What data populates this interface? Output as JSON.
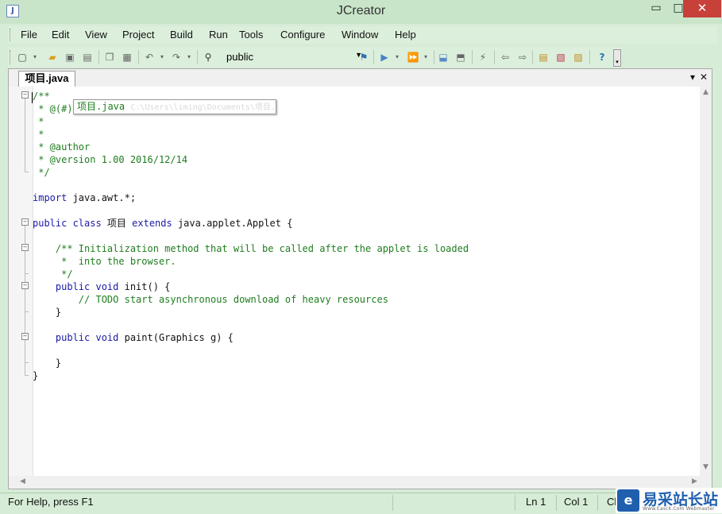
{
  "window": {
    "title": "JCreator",
    "app_icon": "jcreator-icon",
    "controls": {
      "minimize": "▭",
      "maximize": "□",
      "close": "✕"
    }
  },
  "menu": [
    "File",
    "Edit",
    "View",
    "Project",
    "Build",
    "Run",
    "Tools",
    "Configure",
    "Window",
    "Help"
  ],
  "toolbar": {
    "find_value": "public",
    "icons": [
      "new-icon",
      "open-icon",
      "save-icon",
      "save-all-icon",
      "copy-icon",
      "paste-icon",
      "undo-icon",
      "redo-icon",
      "find-icon",
      "find-in-files-icon",
      "run-icon",
      "debug-icon",
      "compile-file-icon",
      "build-project-icon",
      "stop-icon",
      "back-icon",
      "forward-icon",
      "bookmark-icon",
      "toggle-icon",
      "options-icon",
      "help-icon"
    ]
  },
  "editor": {
    "tab_label": "项目.java",
    "tab_controls": {
      "list": "▾",
      "close": "✕"
    },
    "tooltip_text": "项目.java",
    "tooltip_ghost": "C:\\Users\\liming\\Documents\\项目.java",
    "code_lines": [
      {
        "parts": [
          {
            "t": "/**",
            "c": "cm"
          }
        ]
      },
      {
        "parts": [
          {
            "t": " * @(#)",
            "c": "cm"
          }
        ]
      },
      {
        "parts": [
          {
            "t": " *",
            "c": "cm"
          }
        ]
      },
      {
        "parts": [
          {
            "t": " *",
            "c": "cm"
          }
        ]
      },
      {
        "parts": [
          {
            "t": " * @author",
            "c": "cm"
          }
        ]
      },
      {
        "parts": [
          {
            "t": " * @version 1.00 2016/12/14",
            "c": "cm"
          }
        ]
      },
      {
        "parts": [
          {
            "t": " */",
            "c": "cm"
          }
        ]
      },
      {
        "parts": []
      },
      {
        "parts": [
          {
            "t": "import",
            "c": "kw"
          },
          {
            "t": " java.awt.*;",
            "c": "pl"
          }
        ]
      },
      {
        "parts": []
      },
      {
        "parts": [
          {
            "t": "public class",
            "c": "kw"
          },
          {
            "t": " 项目 ",
            "c": "pl"
          },
          {
            "t": "extends",
            "c": "kw"
          },
          {
            "t": " java.applet.Applet {",
            "c": "pl"
          }
        ]
      },
      {
        "parts": []
      },
      {
        "parts": [
          {
            "t": "    /** Initialization method that will be called after the applet is loaded",
            "c": "cm"
          }
        ]
      },
      {
        "parts": [
          {
            "t": "     *  into the browser.",
            "c": "cm"
          }
        ]
      },
      {
        "parts": [
          {
            "t": "     */",
            "c": "cm"
          }
        ]
      },
      {
        "parts": [
          {
            "t": "    public void",
            "c": "kw"
          },
          {
            "t": " init() {",
            "c": "pl"
          }
        ]
      },
      {
        "parts": [
          {
            "t": "        // TODO start asynchronous download of heavy resources",
            "c": "cm"
          }
        ]
      },
      {
        "parts": [
          {
            "t": "    }",
            "c": "pl"
          }
        ]
      },
      {
        "parts": []
      },
      {
        "parts": [
          {
            "t": "    public void",
            "c": "kw"
          },
          {
            "t": " paint(Graphics g) {",
            "c": "pl"
          }
        ]
      },
      {
        "parts": []
      },
      {
        "parts": [
          {
            "t": "    }",
            "c": "pl"
          }
        ]
      },
      {
        "parts": [
          {
            "t": "}",
            "c": "pl"
          }
        ]
      }
    ]
  },
  "status": {
    "help": "For Help, press F1",
    "ln": "Ln 1",
    "col": "Col 1",
    "extra": "Cl"
  },
  "watermark": {
    "cn": "易采站长站",
    "en": "Www.Easck.Com  Webmaster"
  }
}
